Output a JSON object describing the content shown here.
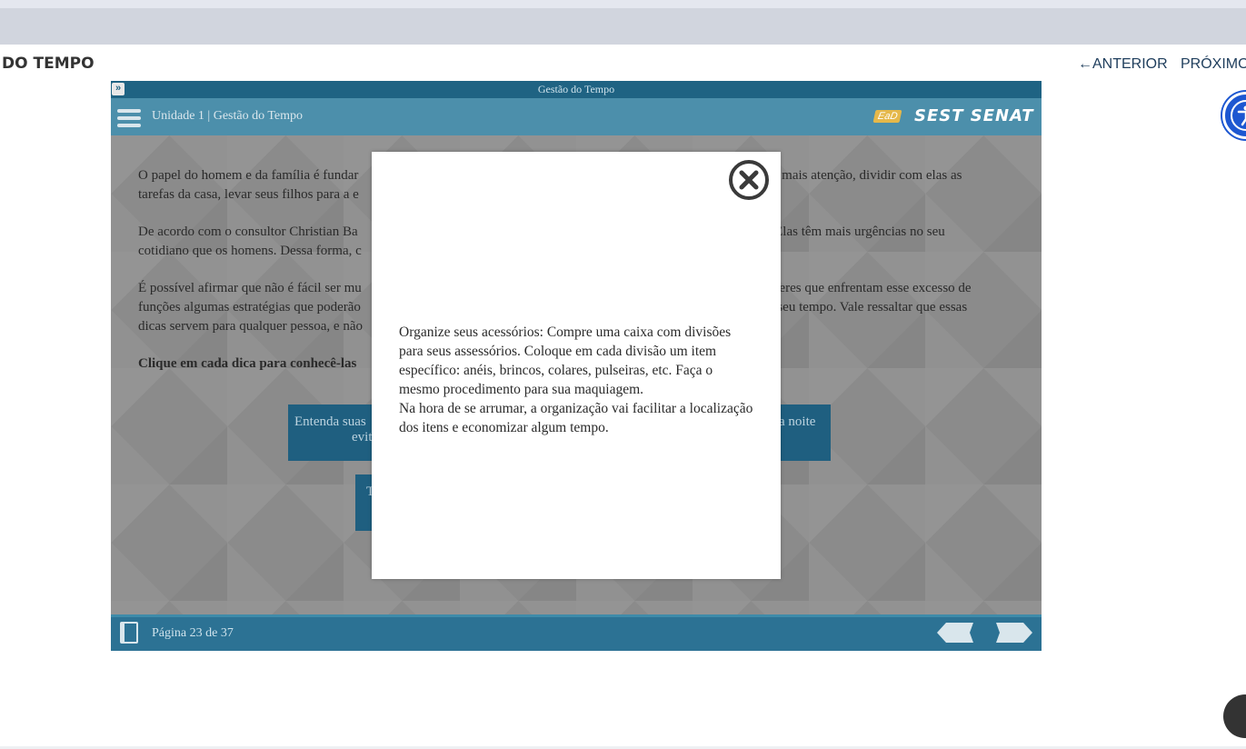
{
  "page": {
    "course_title": "DO TEMPO",
    "nav_prev": "ANTERIOR",
    "nav_next": "PRÓXIMO",
    "nav_prev_arrow": "←"
  },
  "player": {
    "window_title": "Gestão do Tempo",
    "expand_icon": "»",
    "unit_label": "Unidade 1 | Gestão do Tempo",
    "logo_ead": "EaD",
    "logo_brand": "SEST SENAT",
    "page_label": "Página 23 de 37"
  },
  "content": {
    "p1": "O papel do homem e da família é fundar                                                                                                          r mais atenção, dividir com elas as tarefas da casa, levar seus filhos para a e",
    "p1_left_a": "O papel do homem e da família é fundar",
    "p1_right_a": "r mais atenção, dividir com elas as",
    "p1_left_b": "tarefas da casa, levar seus filhos para a e",
    "p2_left_a": "De acordo com o consultor Christian Ba",
    "p2_right_a": ". Elas têm mais urgências no seu",
    "p2_left_b": "cotidiano que os homens. Dessa forma, c",
    "p3_left_a": "É possível afirmar que não é fácil ser mu",
    "p3_right_a": "lheres que enfrentam esse excesso de",
    "p3_left_b": "funções algumas estratégias que poderão",
    "p3_right_b": "e seu tempo. Vale ressaltar que essas",
    "p3_left_c": "dicas servem para qualquer pessoa, e não",
    "p4": "Clique em cada dica para conhecê-las",
    "tip1_left_a": "Entenda suas",
    "tip1_left_b": "evit",
    "tip1_right": "a noite",
    "tip2": "T"
  },
  "modal": {
    "text_line1": "Organize seus acessórios: Compre uma caixa com divisões para seus assessórios. Coloque em cada divisão um item específico: anéis, brincos, colares, pulseiras, etc. Faça o mesmo procedimento para sua maquiagem.",
    "text_line2": "Na hora de se arrumar, a organização vai facilitar a localização dos itens e economizar algum tempo."
  },
  "icons": {
    "close": "close-circle-icon",
    "menu": "hamburger-menu-icon",
    "book": "book-icon",
    "accessibility": "accessibility-icon",
    "hint": "lightbulb-icon"
  },
  "colors": {
    "title_bar": "#1f6383",
    "header": "#4c8fab",
    "footer": "#2c7294",
    "tip_button": "#1f5f80",
    "accessibility": "#1d57d1",
    "logo_ead": "#e5b84a"
  }
}
